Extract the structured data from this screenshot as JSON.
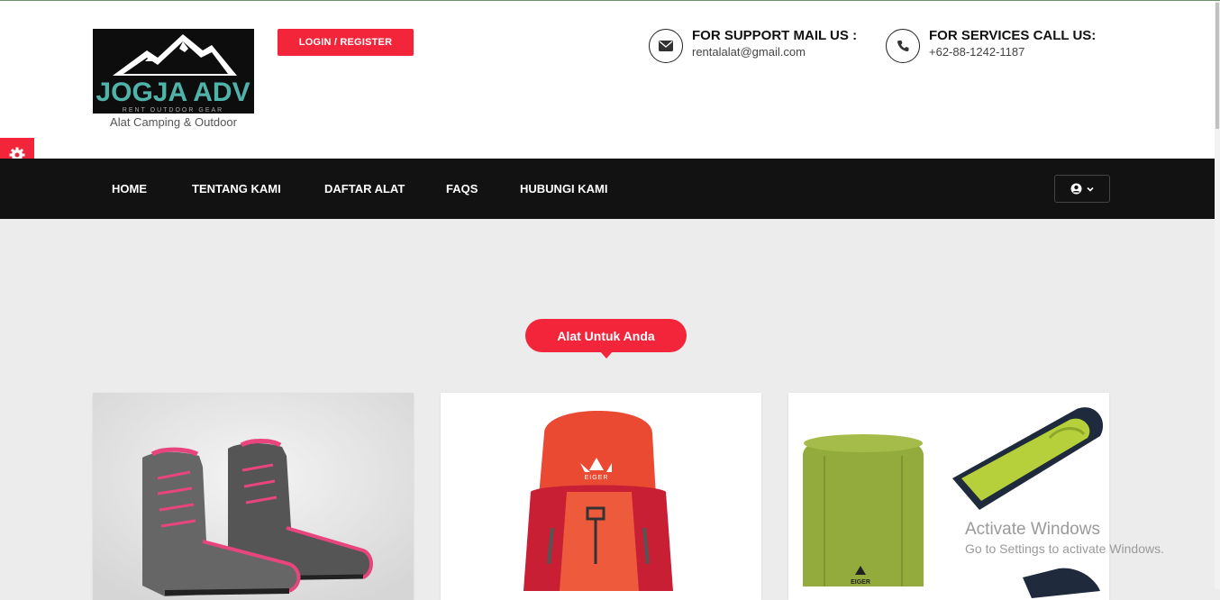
{
  "brand": {
    "logo_text": "JOGJA ADV",
    "logo_subtext": "RENT OUTDOOR GEAR",
    "tagline": "Alat Camping & Outdoor"
  },
  "header": {
    "login_label": "LOGIN / REGISTER",
    "support": {
      "title": "FOR SUPPORT MAIL US :",
      "value": "rentalalat@gmail.com",
      "icon": "envelope-icon"
    },
    "services": {
      "title": "FOR SERVICES CALL US:",
      "value": "+62-88-1242-1187",
      "icon": "phone-icon"
    }
  },
  "nav": {
    "items": [
      {
        "label": "HOME"
      },
      {
        "label": "TENTANG KAMI"
      },
      {
        "label": "DAFTAR ALAT"
      },
      {
        "label": "FAQS"
      },
      {
        "label": "HUBUNGI KAMI"
      }
    ],
    "user_icon": "user-circle-icon"
  },
  "section": {
    "title": "Alat Untuk Anda"
  },
  "products": [
    {
      "image": "hiking-boots",
      "brand_mark": ""
    },
    {
      "image": "backpack",
      "brand_mark": "EIGER"
    },
    {
      "image": "sleeping-bag",
      "brand_mark": "EIGER"
    }
  ],
  "watermark": {
    "line1": "Activate Windows",
    "line2": "Go to Settings to activate Windows."
  },
  "colors": {
    "accent": "#f3253a",
    "navbar": "#121212",
    "background": "#ececec"
  }
}
